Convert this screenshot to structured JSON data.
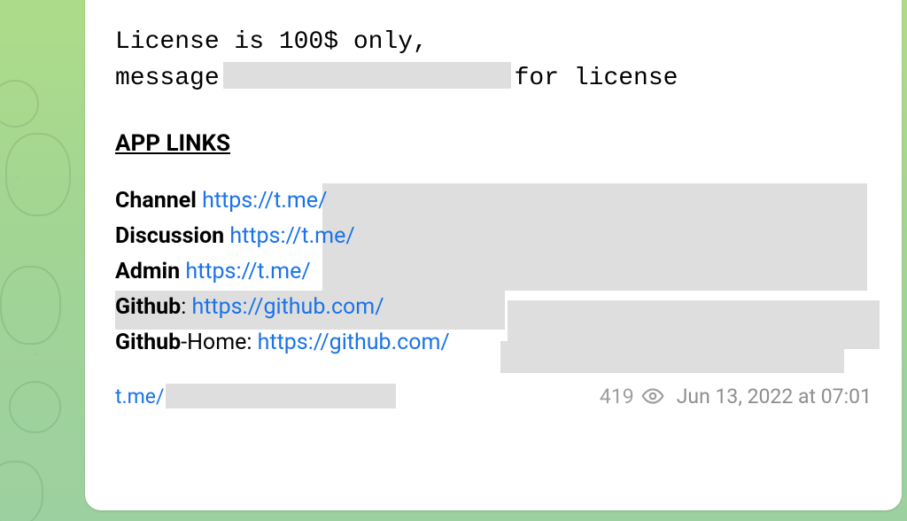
{
  "license_block": {
    "line1": "License is 100$ only,",
    "line2_prefix": "message",
    "line2_suffix": "for license"
  },
  "section_title": "APP LINKS",
  "links": {
    "channel_label": "Channel",
    "channel_url": "https://t.me/",
    "discussion_label": "Discussion",
    "discussion_url": "https://t.me/",
    "admin_label": "Admin",
    "admin_url": "https://t.me/",
    "github_label": "Github",
    "github_url": "https://github.com/",
    "github_home_bold": "Github",
    "github_home_rest": "-Home: ",
    "github_home_url": "https://github.com/"
  },
  "footer": {
    "source_link": "t.me/",
    "views": "419",
    "timestamp": "Jun 13, 2022 at 07:01"
  }
}
